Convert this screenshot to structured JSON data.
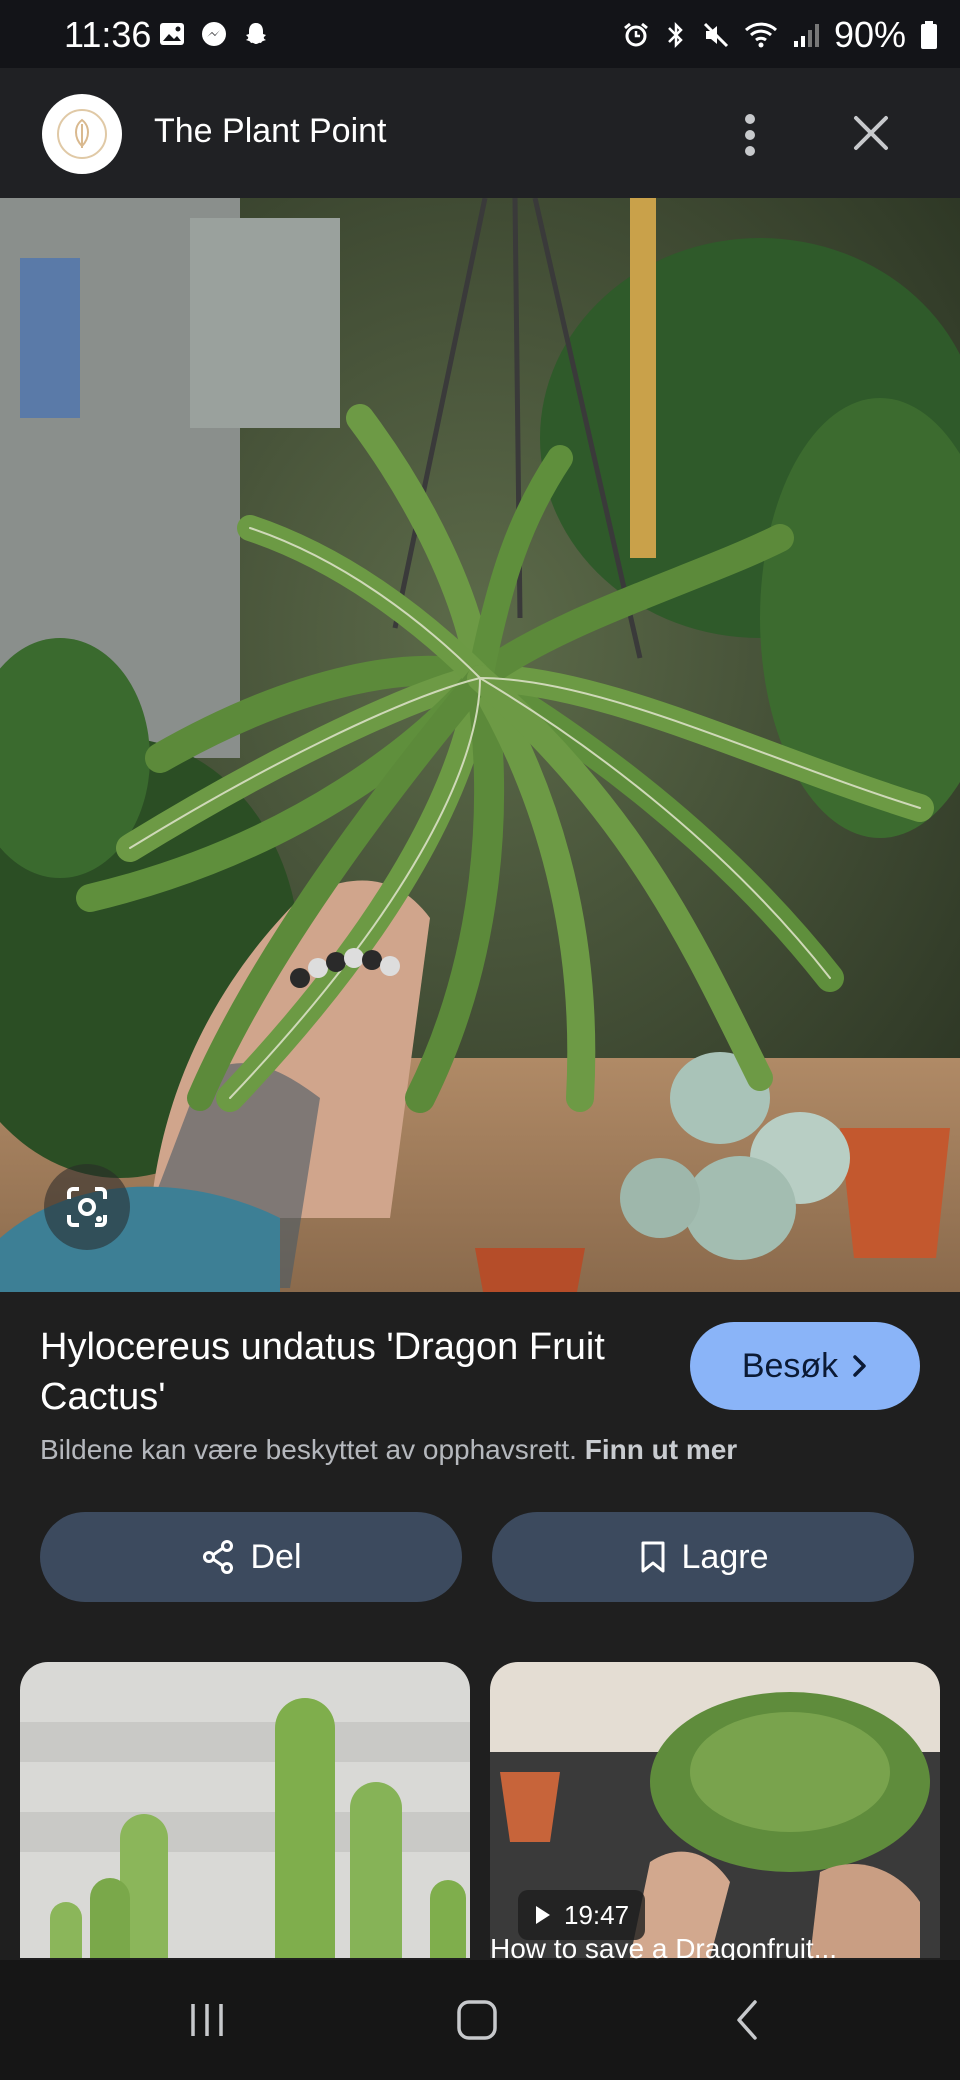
{
  "status_bar": {
    "time": "11:36",
    "battery": "90%",
    "left_icons": [
      "gallery-icon",
      "messenger-icon",
      "snapchat-icon"
    ],
    "right_icons": [
      "alarm-icon",
      "bluetooth-icon",
      "mute-icon",
      "wifi-icon",
      "signal-icon",
      "battery-icon"
    ]
  },
  "header": {
    "site_name": "The Plant Point",
    "more_icon": "more-vert-icon",
    "close_icon": "close-icon"
  },
  "result": {
    "title": "Hylocereus undatus 'Dragon Fruit Cactus'",
    "visit_label": "Besøk",
    "copyright_text": "Bildene kan være beskyttet av opphavsrett.",
    "learn_more": "Finn ut mer",
    "share_label": "Del",
    "save_label": "Lagre",
    "accent_color": "#8ab4f8",
    "pill_color": "#3c4a5e"
  },
  "related": [
    {
      "duration": "",
      "caption": ""
    },
    {
      "duration": "19:47",
      "caption": "How to save a Dragonfruit..."
    }
  ],
  "nav": {
    "icons": [
      "recent-apps-icon",
      "home-icon",
      "back-icon"
    ]
  }
}
